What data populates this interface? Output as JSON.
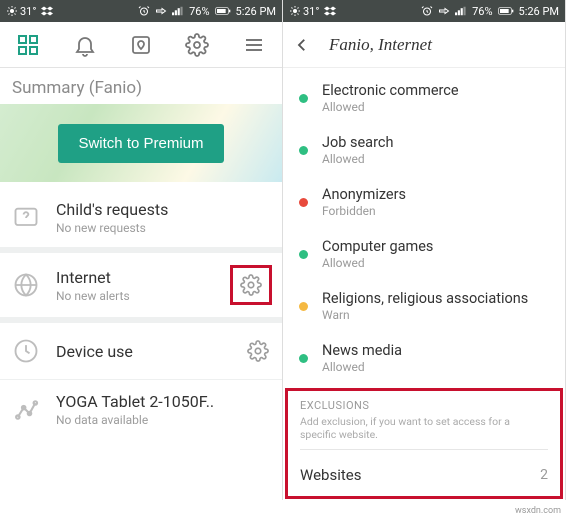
{
  "statusbar": {
    "weather": "31°",
    "signal": "76%",
    "time": "5:26 PM"
  },
  "left": {
    "summary_title": "Summary (Fanio)",
    "premium_button": "Switch to Premium",
    "rows": [
      {
        "title": "Child's requests",
        "sub": "No new requests"
      },
      {
        "title": "Internet",
        "sub": "No new alerts"
      },
      {
        "title": "Device use",
        "sub": ""
      },
      {
        "title": "YOGA Tablet 2-1050F..",
        "sub": "No data available"
      }
    ]
  },
  "right": {
    "header_title": "Fanio, Internet",
    "categories": [
      {
        "name": "Electronic commerce",
        "status": "Allowed",
        "color": "#2fbf82"
      },
      {
        "name": "Job search",
        "status": "Allowed",
        "color": "#2fbf82"
      },
      {
        "name": "Anonymizers",
        "status": "Forbidden",
        "color": "#e84a3c"
      },
      {
        "name": "Computer games",
        "status": "Allowed",
        "color": "#2fbf82"
      },
      {
        "name": "Religions, religious associations",
        "status": "Warn",
        "color": "#f5b942"
      },
      {
        "name": "News media",
        "status": "Allowed",
        "color": "#2fbf82"
      }
    ],
    "exclusions": {
      "label": "EXCLUSIONS",
      "hint": "Add exclusion, if you want to set access for a specific website.",
      "websites_label": "Websites",
      "websites_count": "2"
    }
  },
  "watermark": "wsxdn.com"
}
